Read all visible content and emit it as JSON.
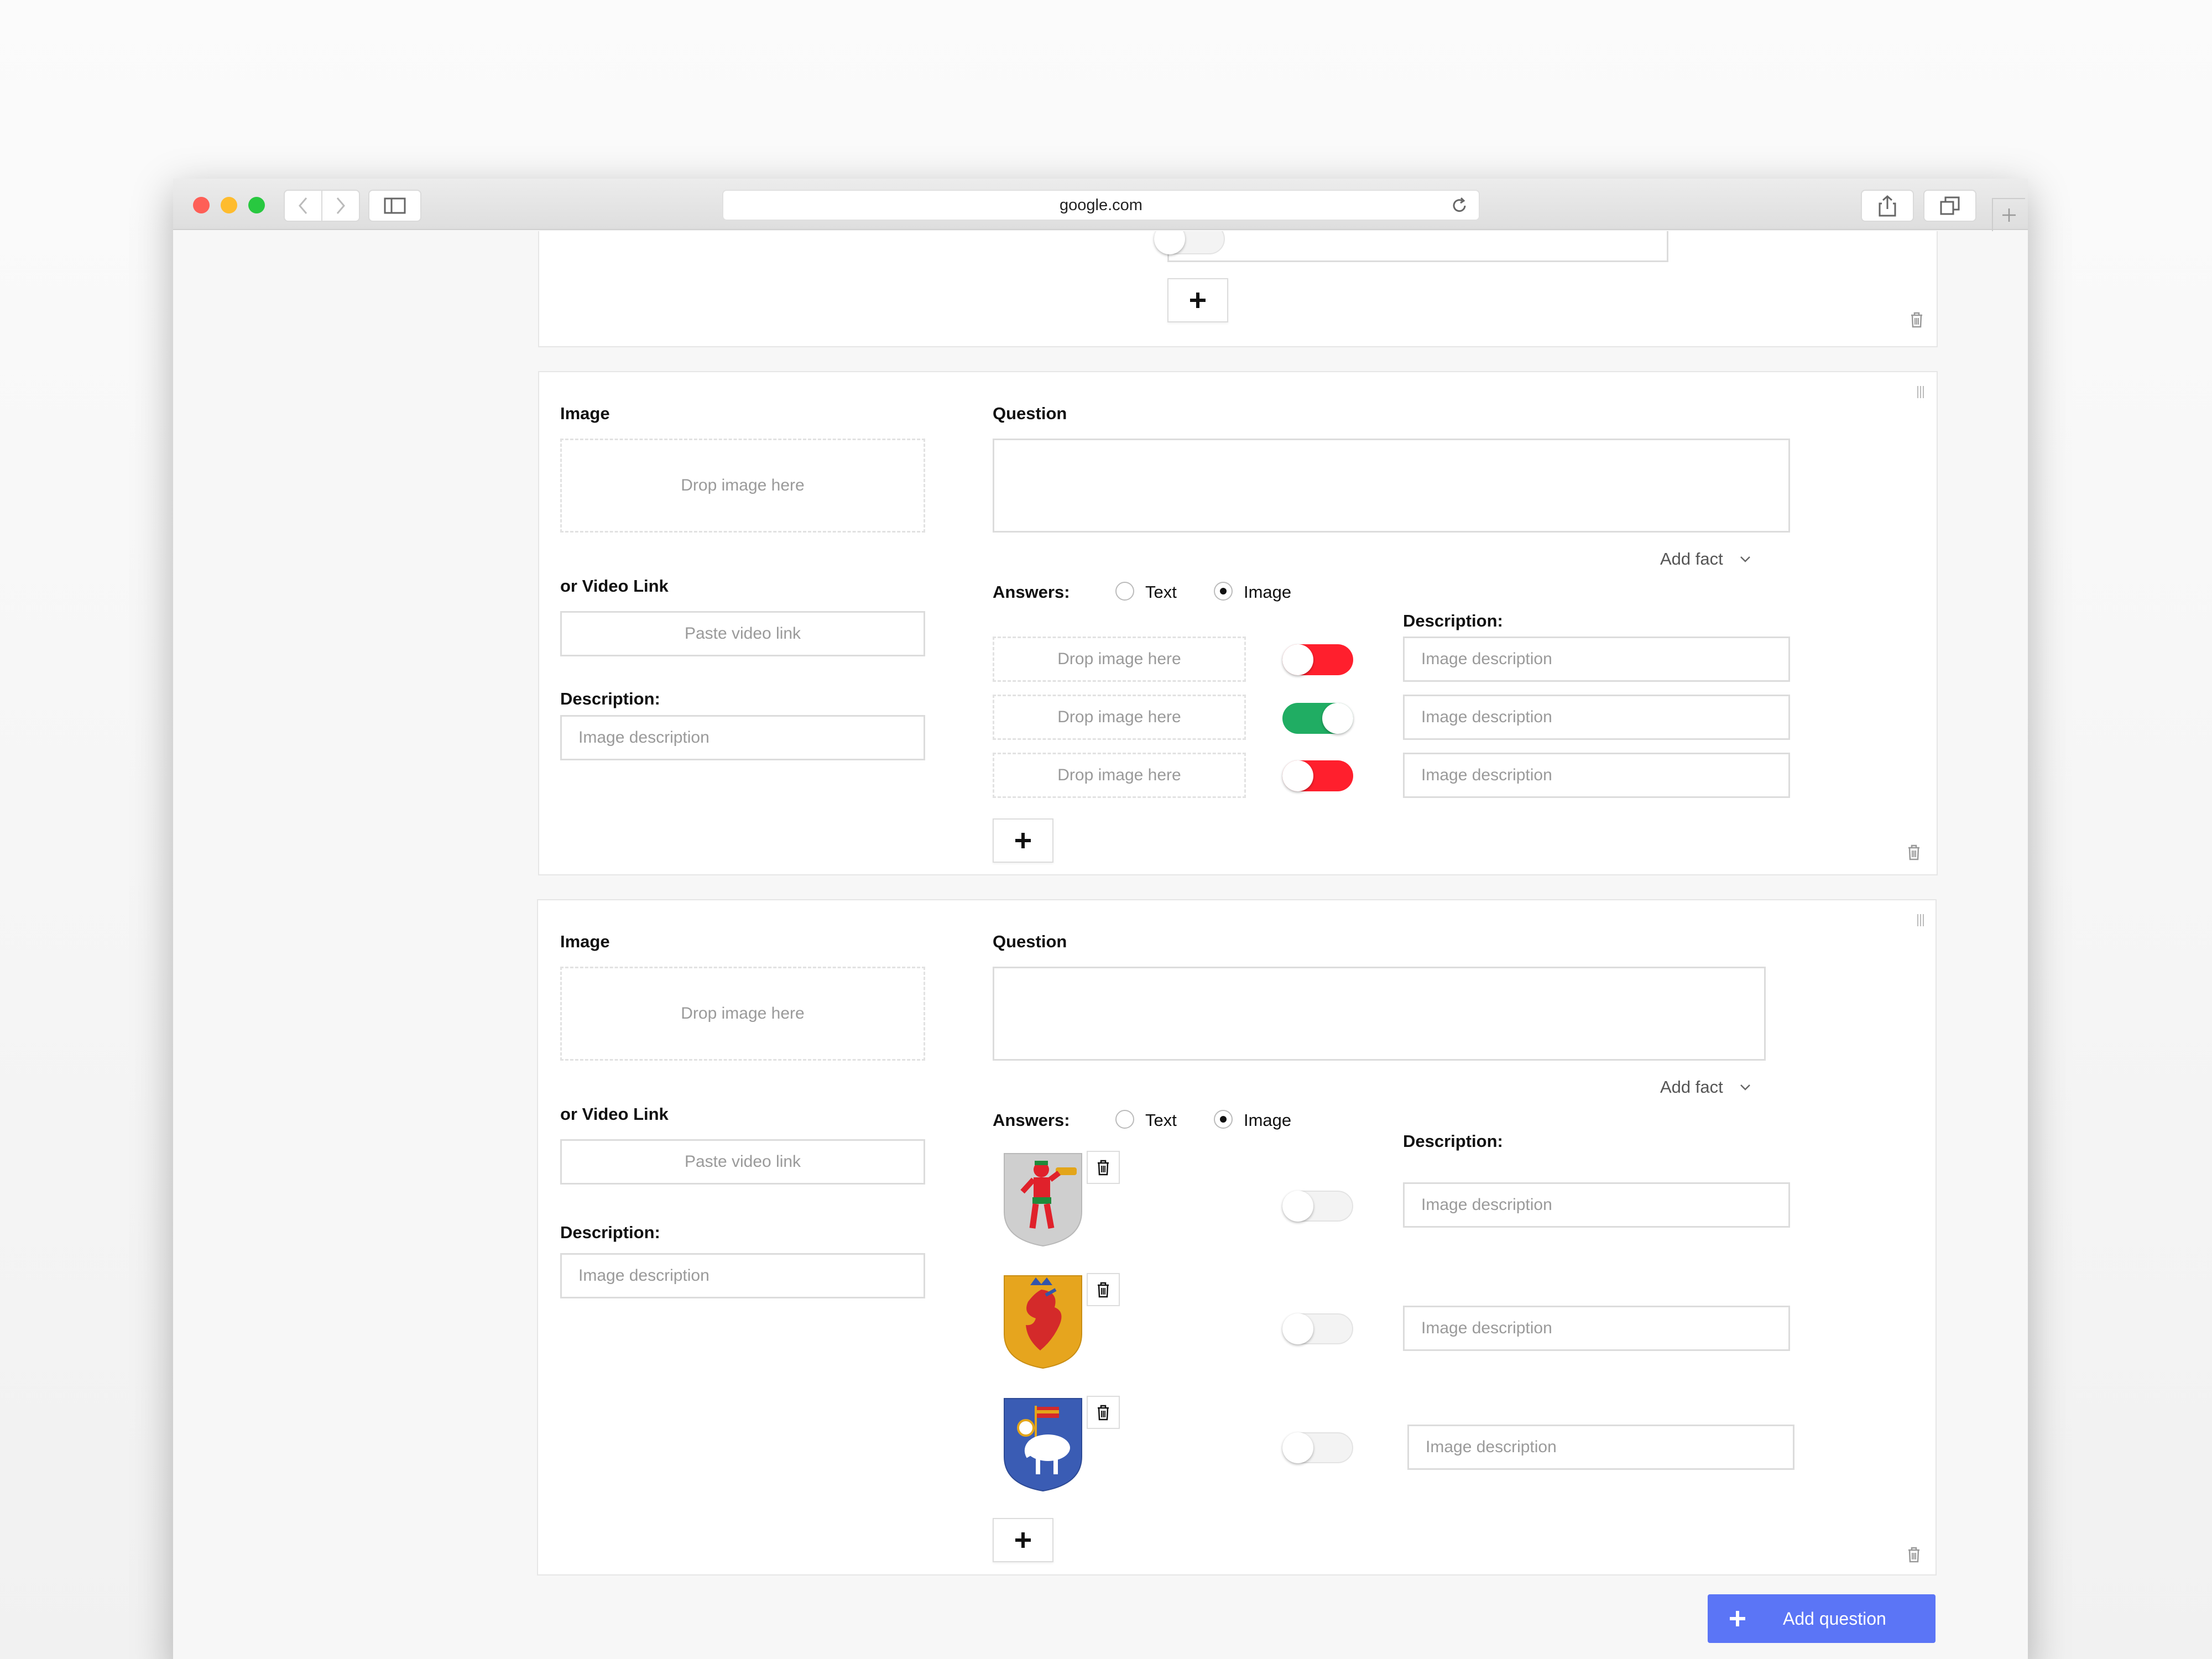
{
  "browser": {
    "url": "google.com",
    "colors": {
      "close": "#fe5f57",
      "minimize": "#febc2e",
      "zoom": "#28c840"
    }
  },
  "icons": {
    "plus": "plus-icon",
    "trash": "trash-icon",
    "drag": "drag-handle-icon",
    "chevron": "chevron-down-icon"
  },
  "top_card": {
    "toggle_state": "off"
  },
  "question_cards": [
    {
      "image_label": "Image",
      "drop_label": "Drop image here",
      "video_label": "or Video Link",
      "video_placeholder": "Paste video link",
      "description_label": "Description:",
      "description_placeholder": "Image description",
      "question_label": "Question",
      "question_value": "",
      "add_fact_label": "Add fact",
      "answers_label": "Answers:",
      "answer_types": [
        "Text",
        "Image"
      ],
      "selected_answer_type": "Image",
      "answers_description_label": "Description:",
      "answers": [
        {
          "drop_label": "Drop image here",
          "correct": false,
          "description_placeholder": "Image description"
        },
        {
          "drop_label": "Drop image here",
          "correct": true,
          "description_placeholder": "Image description"
        },
        {
          "drop_label": "Drop image here",
          "correct": false,
          "description_placeholder": "Image description"
        }
      ]
    },
    {
      "image_label": "Image",
      "drop_label": "Drop image here",
      "video_label": "or Video Link",
      "video_placeholder": "Paste video link",
      "description_label": "Description:",
      "description_placeholder": "Image description",
      "question_label": "Question",
      "question_value": "",
      "add_fact_label": "Add fact",
      "answers_label": "Answers:",
      "answer_types": [
        "Text",
        "Image"
      ],
      "selected_answer_type": "Image",
      "answers_description_label": "Description:",
      "answers": [
        {
          "image": "coat-of-arms-red-figure",
          "toggle": "off",
          "description_placeholder": "Image description"
        },
        {
          "image": "coat-of-arms-gold-griffin",
          "toggle": "off",
          "description_placeholder": "Image description"
        },
        {
          "image": "coat-of-arms-blue-ram",
          "toggle": "off",
          "description_placeholder": "Image description"
        }
      ]
    }
  ],
  "footer": {
    "add_question_label": "Add question",
    "accent_color": "#5b75f6"
  }
}
